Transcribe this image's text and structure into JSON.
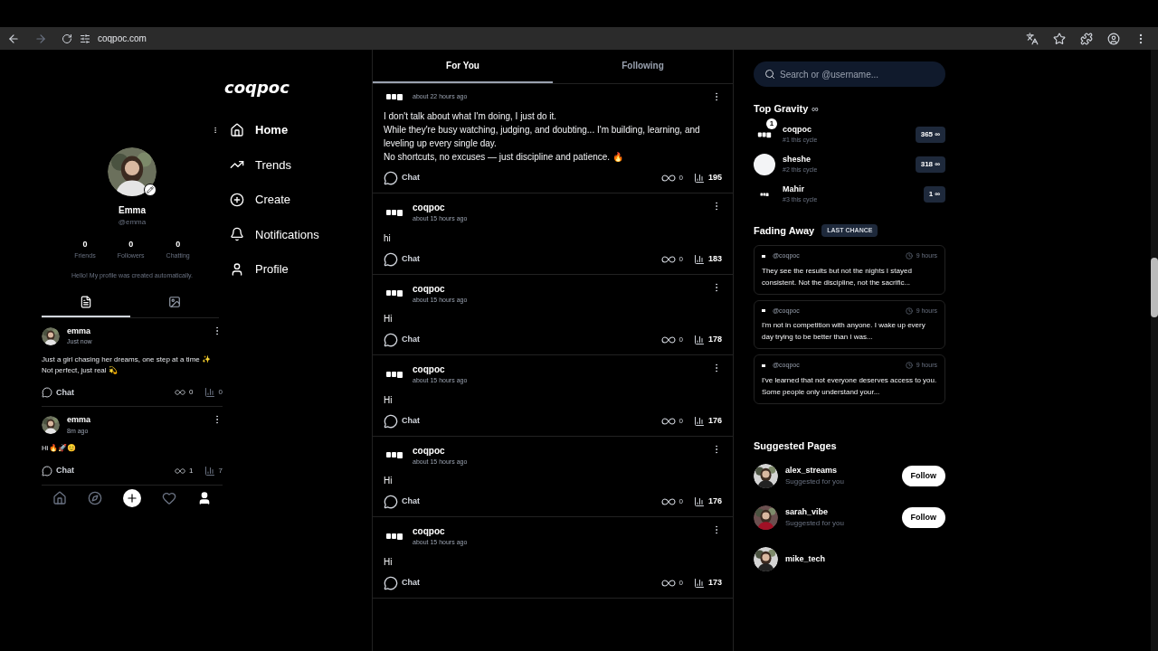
{
  "browser": {
    "url": "coqpoc.com"
  },
  "logo": "coqpoc",
  "nav": [
    {
      "kind": "home",
      "label": "Home",
      "selected": true
    },
    {
      "kind": "trends",
      "label": "Trends",
      "selected": false
    },
    {
      "kind": "create",
      "label": "Create",
      "selected": false
    },
    {
      "kind": "notifications",
      "label": "Notifications",
      "selected": false
    },
    {
      "kind": "profile",
      "label": "Profile",
      "selected": false
    }
  ],
  "profile": {
    "name": "Emma",
    "handle": "@emma",
    "stats": [
      {
        "value": "0",
        "label": "Friends"
      },
      {
        "value": "0",
        "label": "Followers"
      },
      {
        "value": "0",
        "label": "Chatting"
      }
    ],
    "bio": "Hello! My profile was created automatically.",
    "tabs": [
      {
        "kind": "posts",
        "selected": true
      },
      {
        "kind": "media",
        "selected": false
      }
    ],
    "posts": [
      {
        "user": "emma",
        "time": "Just now",
        "lines": [
          "Just a girl chasing her dreams, one step at a time ✨",
          "Not perfect, just real 💫"
        ],
        "chat": "Chat",
        "likes": "0",
        "views": "0"
      },
      {
        "user": "emma",
        "time": "8m ago",
        "lines": [
          "Hi🔥🚀😊"
        ],
        "chat": "Chat",
        "likes": "1",
        "views": "7"
      }
    ]
  },
  "bottom_nav": [
    {
      "kind": "home",
      "selected": false
    },
    {
      "kind": "explore",
      "selected": false
    },
    {
      "kind": "create",
      "selected": false
    },
    {
      "kind": "likes",
      "selected": false
    },
    {
      "kind": "profile",
      "selected": true
    }
  ],
  "feed": {
    "tabs": [
      {
        "label": "For You",
        "selected": true
      },
      {
        "label": "Following",
        "selected": false
      }
    ],
    "posts": [
      {
        "time": "about 22 hours ago",
        "lines": [
          "I don't talk about what I'm doing, I just do it.",
          "While they're busy watching, judging, and doubting... I'm building, learning, and leveling up every single day.",
          "No shortcuts, no excuses — just discipline and patience. 🔥"
        ],
        "chat": "Chat",
        "likes": "0",
        "views": "195"
      },
      {
        "user": "coqpoc",
        "time": "about 15 hours ago",
        "lines": [
          "hi"
        ],
        "chat": "Chat",
        "likes": "0",
        "views": "183"
      },
      {
        "user": "coqpoc",
        "time": "about 15 hours ago",
        "lines": [
          "Hi"
        ],
        "chat": "Chat",
        "likes": "0",
        "views": "178"
      },
      {
        "user": "coqpoc",
        "time": "about 15 hours ago",
        "lines": [
          "Hi"
        ],
        "chat": "Chat",
        "likes": "0",
        "views": "176"
      },
      {
        "user": "coqpoc",
        "time": "about 15 hours ago",
        "lines": [
          "Hi"
        ],
        "chat": "Chat",
        "likes": "0",
        "views": "176"
      },
      {
        "user": "coqpoc",
        "time": "about 15 hours ago",
        "lines": [
          "Hi"
        ],
        "chat": "Chat",
        "likes": "0",
        "views": "173"
      }
    ]
  },
  "sidebar": {
    "search": {
      "placeholder": "Search or @username..."
    },
    "top_gravity": {
      "title": "Top Gravity",
      "symbol": "∞",
      "entries": [
        {
          "kind": "logo",
          "name": "coqpoc",
          "rank": "#1 this cycle",
          "score": "365 ∞",
          "badge": "1"
        },
        {
          "kind": "blank",
          "name": "sheshe",
          "rank": "#2 this cycle",
          "score": "318 ∞"
        },
        {
          "kind": "logo",
          "name": "Mahir",
          "rank": "#3 this cycle",
          "score": "1 ∞"
        }
      ]
    },
    "fading": {
      "title": "Fading Away",
      "badge": "LAST CHANCE",
      "cards": [
        {
          "handle": "@coqpoc",
          "time": "9 hours",
          "text": "They see the results but not the nights I stayed consistent. Not the discipline, not the sacrific..."
        },
        {
          "handle": "@coqpoc",
          "time": "9 hours",
          "text": "I'm not in competition with anyone. I wake up every day trying to be better than I was..."
        },
        {
          "handle": "@coqpoc",
          "time": "9 hours",
          "text": "I've learned that not everyone deserves access to you. Some people only understand your..."
        }
      ]
    },
    "suggested": {
      "title": "Suggested Pages",
      "pages": [
        {
          "name": "alex_streams",
          "subtitle": "Suggested for you",
          "button": "Follow"
        },
        {
          "name": "sarah_vibe",
          "subtitle": "Suggested for you",
          "button": "Follow"
        },
        {
          "name": "mike_tech"
        }
      ]
    }
  }
}
